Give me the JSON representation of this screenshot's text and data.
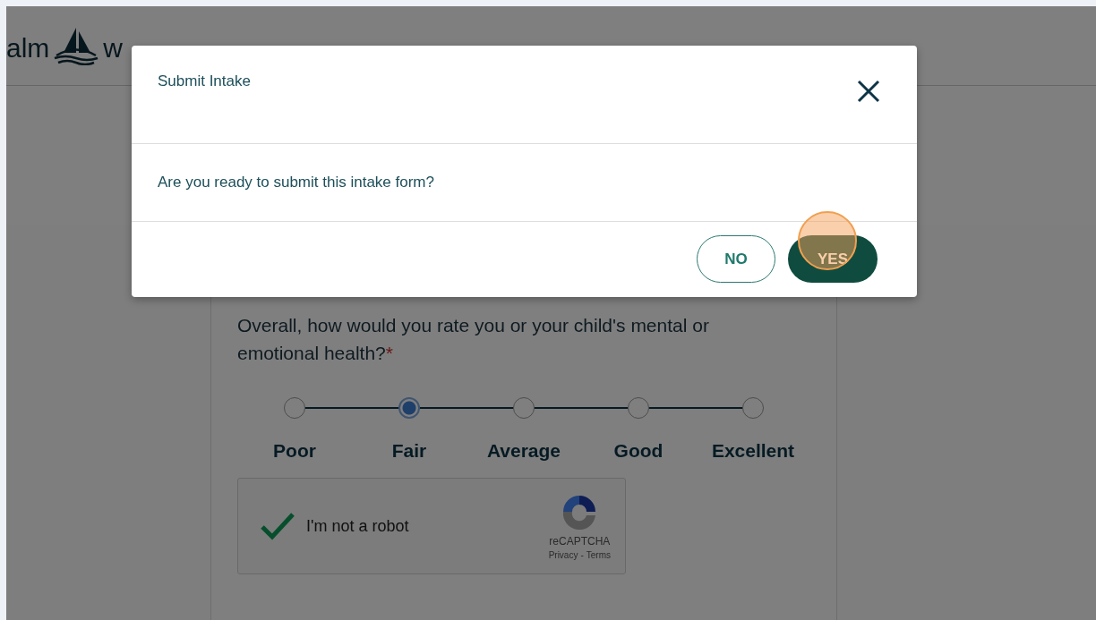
{
  "header": {
    "logo_text_left": "alm",
    "logo_text_right": "w"
  },
  "question": {
    "text": "Overall, how would you rate you or your child's mental or emotional health?",
    "required_mark": "*"
  },
  "rating": {
    "options": [
      {
        "label": "Poor",
        "selected": false
      },
      {
        "label": "Fair",
        "selected": true
      },
      {
        "label": "Average",
        "selected": false
      },
      {
        "label": "Good",
        "selected": false
      },
      {
        "label": "Excellent",
        "selected": false
      }
    ]
  },
  "captcha": {
    "label": "I'm not a robot",
    "checked": true,
    "brand": "reCAPTCHA",
    "privacy_link": "Privacy",
    "separator": "-",
    "terms_link": "Terms"
  },
  "dialog": {
    "title": "Submit Intake",
    "message": "Are you ready to submit this intake form?",
    "buttons": [
      {
        "label": "NO",
        "kind": "secondary"
      },
      {
        "label": "YES",
        "kind": "primary"
      }
    ]
  }
}
